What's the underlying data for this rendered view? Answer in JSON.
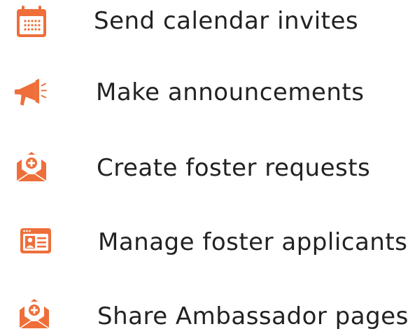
{
  "accent_color": "#EE6F3A",
  "text_color": "#222222",
  "features": [
    {
      "icon": "calendar-icon",
      "label": "Send calendar invites"
    },
    {
      "icon": "megaphone-icon",
      "label": "Make announcements"
    },
    {
      "icon": "envelope-plus-icon",
      "label": "Create foster requests"
    },
    {
      "icon": "profile-card-icon",
      "label": "Manage foster applicants"
    },
    {
      "icon": "envelope-plus-icon",
      "label": "Share Ambassador pages"
    }
  ]
}
